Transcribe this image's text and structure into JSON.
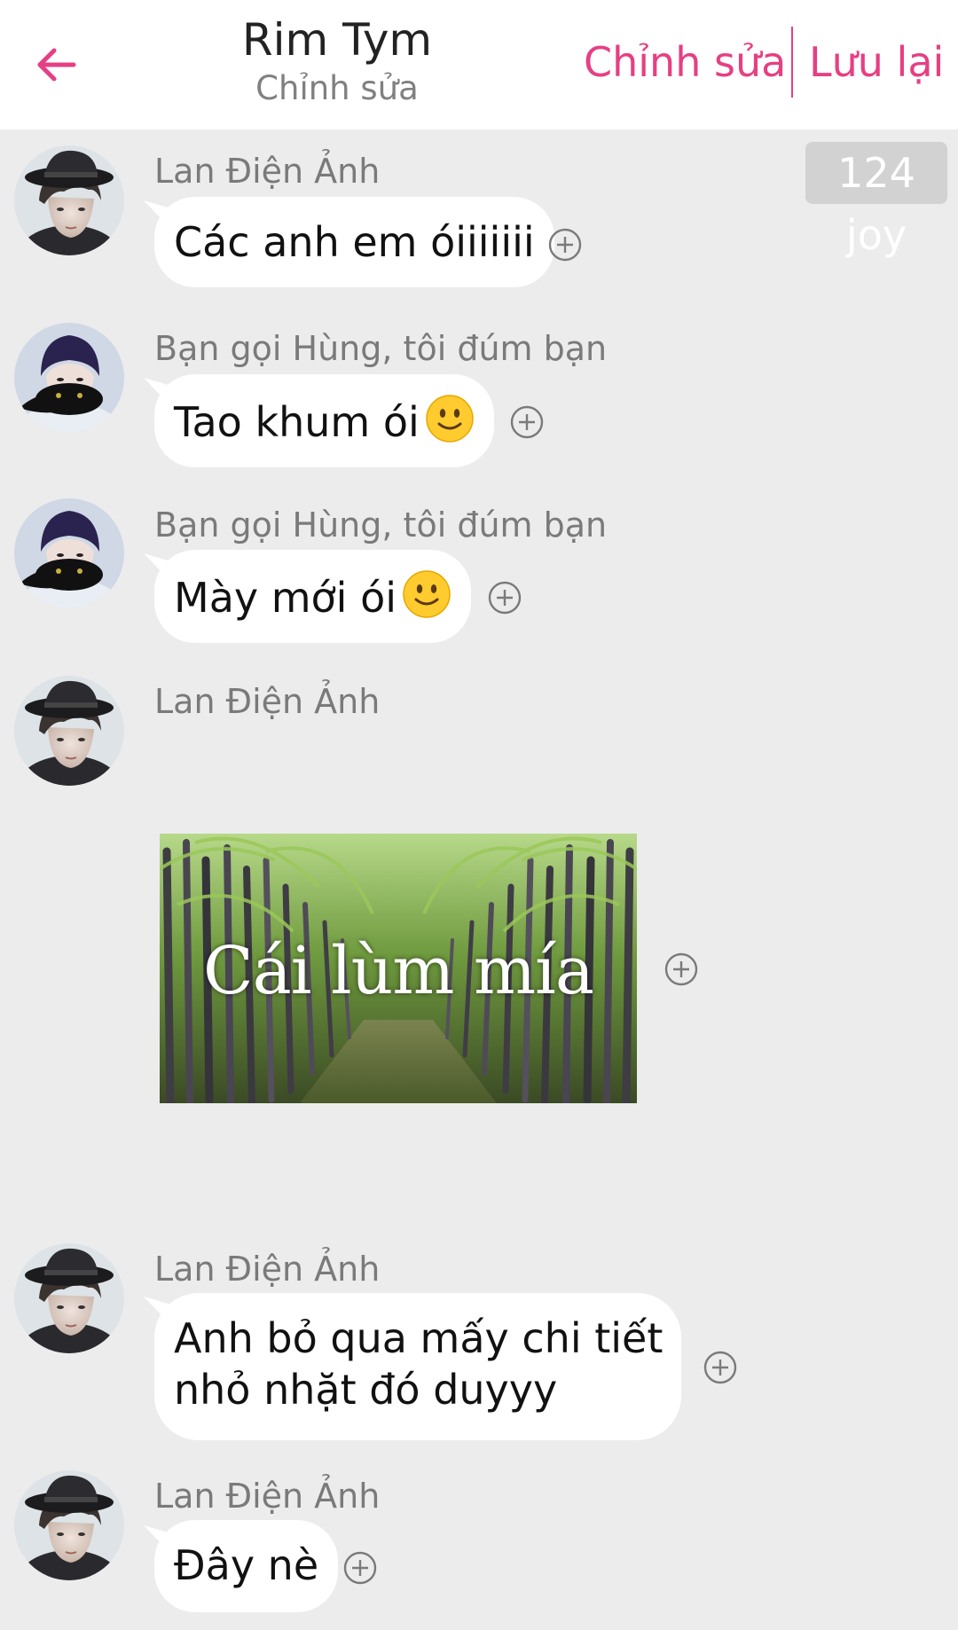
{
  "header": {
    "title": "Rim Tym",
    "subtitle": "Chỉnh sửa",
    "edit_label": "Chỉnh sửa",
    "save_label": "Lưu lại"
  },
  "badge": {
    "text": "124 joy"
  },
  "messages": [
    {
      "sender": "Lan Điện Ảnh",
      "text": "Các anh em óiiiiiii"
    },
    {
      "sender": "Bạn gọi Hùng, tôi đúm bạn",
      "text": "Tao khum ói"
    },
    {
      "sender": "Bạn gọi Hùng, tôi đúm bạn",
      "text": "Mày mới ói"
    },
    {
      "sender": "Lan Điện Ảnh",
      "image_caption": "Cái lùm mía"
    },
    {
      "sender": "Lan Điện Ảnh",
      "text_line1": "Anh bỏ qua mấy chi tiết",
      "text_line2": "nhỏ nhặt đó duyyy"
    },
    {
      "sender": "Lan Điện Ảnh",
      "text": "Đây nè"
    }
  ],
  "colors": {
    "accent": "#e63f83",
    "background": "#ececec",
    "bubble": "#ffffff",
    "badge": "#d2d2d2"
  },
  "icons": {
    "back": "arrow-left-icon",
    "add_reaction": "plus-circle-icon",
    "emoji": "slightly-smiling-face-emoji"
  }
}
